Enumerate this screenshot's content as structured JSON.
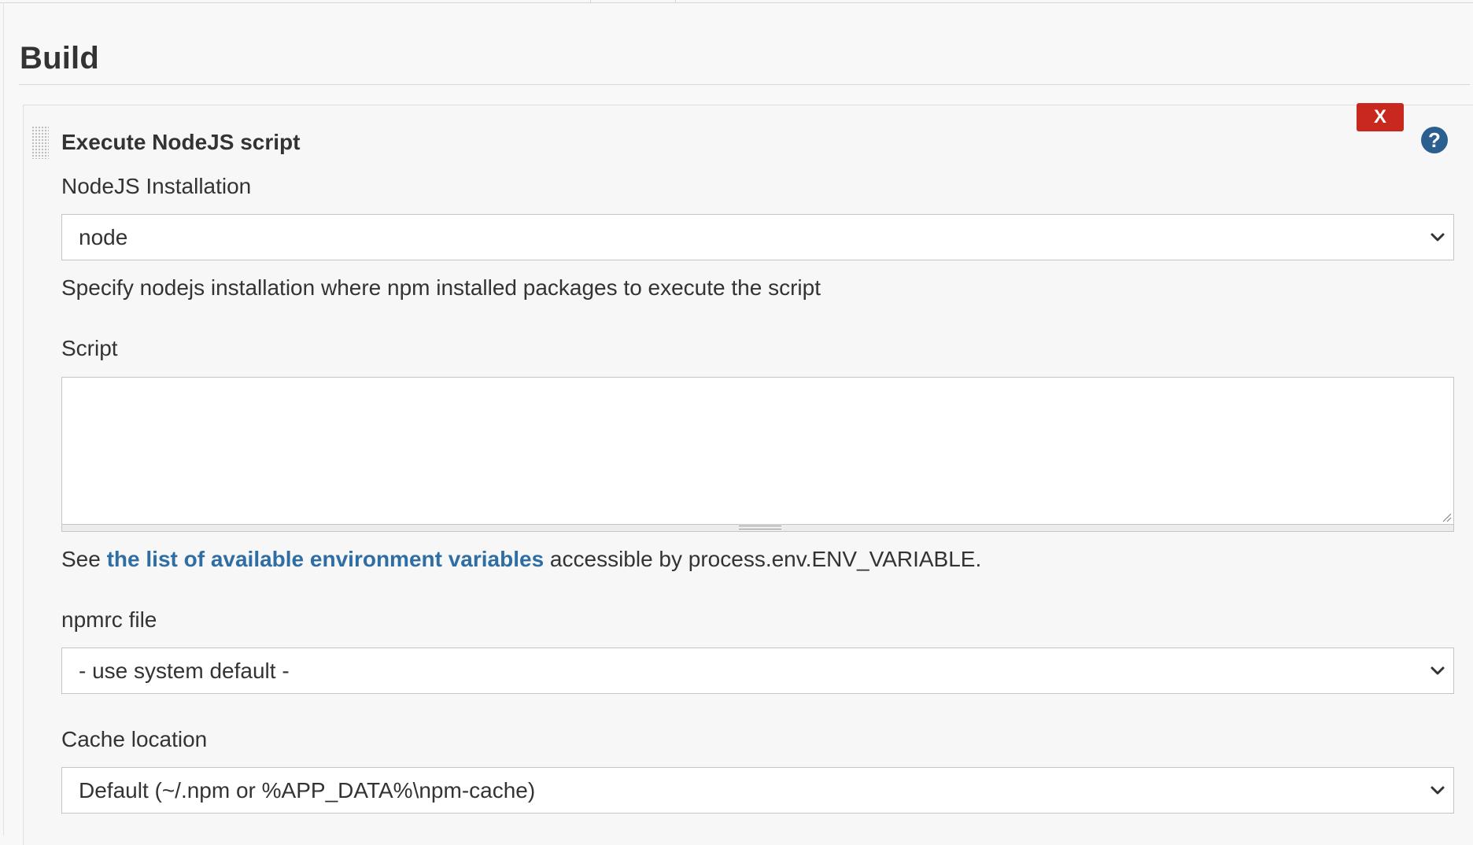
{
  "section": {
    "title": "Build"
  },
  "step": {
    "title": "Execute NodeJS script",
    "delete_label": "X",
    "help_label": "?"
  },
  "nodejs_installation": {
    "label": "NodeJS Installation",
    "selected": "node",
    "help": "Specify nodejs installation where npm installed packages to execute the script"
  },
  "script": {
    "label": "Script",
    "value": "",
    "help_prefix": "See ",
    "help_link": "the list of available environment variables",
    "help_suffix": " accessible by process.env.ENV_VARIABLE."
  },
  "npmrc": {
    "label": "npmrc file",
    "selected": "- use system default -"
  },
  "cache": {
    "label": "Cache location",
    "selected": "Default (~/.npm or %APP_DATA%\\npm-cache)"
  },
  "colors": {
    "delete_button": "#c8281e",
    "help_icon": "#2a5f8f",
    "link": "#2e6ea4",
    "background": "#f8f8f8"
  }
}
